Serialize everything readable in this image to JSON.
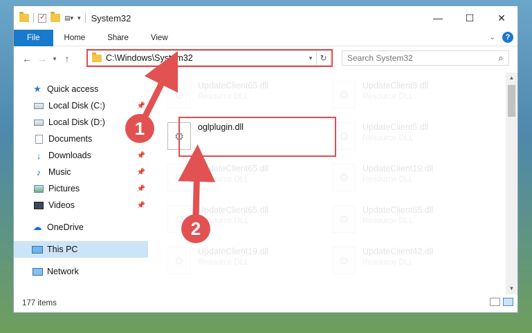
{
  "window": {
    "title": "System32",
    "controls": {
      "minimize": "—",
      "maximize": "☐",
      "close": "✕"
    }
  },
  "ribbon": {
    "tabs": [
      "File",
      "Home",
      "Share",
      "View"
    ]
  },
  "nav": {
    "address": "C:\\Windows\\System32",
    "search_placeholder": "Search System32"
  },
  "sidebar": {
    "items": [
      {
        "label": "Quick access",
        "icon": "star-icon",
        "pinned": false
      },
      {
        "label": "Local Disk (C:)",
        "icon": "disk-icon",
        "pinned": true
      },
      {
        "label": "Local Disk (D:)",
        "icon": "disk-icon",
        "pinned": false
      },
      {
        "label": "Documents",
        "icon": "document-icon",
        "pinned": true
      },
      {
        "label": "Downloads",
        "icon": "download-icon",
        "pinned": true
      },
      {
        "label": "Music",
        "icon": "music-icon",
        "pinned": true
      },
      {
        "label": "Pictures",
        "icon": "pictures-icon",
        "pinned": true
      },
      {
        "label": "Videos",
        "icon": "videos-icon",
        "pinned": true
      },
      {
        "label": "OneDrive",
        "icon": "cloud-icon",
        "pinned": false
      },
      {
        "label": "This PC",
        "icon": "computer-icon",
        "pinned": false,
        "selected": true
      },
      {
        "label": "Network",
        "icon": "network-icon",
        "pinned": false
      }
    ]
  },
  "files": [
    {
      "name": "UpdateClient65.dll",
      "type": "Resource DLL"
    },
    {
      "name": "UpdateClient5.dll",
      "type": "Resource DLL"
    },
    {
      "name": "oglplugin.dll",
      "type": ""
    },
    {
      "name": "UpdateClient5.dll",
      "type": "Resource DLL"
    },
    {
      "name": "UpdateClient65.dll",
      "type": "Resource DLL"
    },
    {
      "name": "UpdateClient19.dll",
      "type": "Resource DLL"
    },
    {
      "name": "UpdateClient65.dll",
      "type": "Resource DLL"
    },
    {
      "name": "UpdateClient65.dll",
      "type": "Resource DLL"
    },
    {
      "name": "UpdateClient19.dll",
      "type": "Resource DLL"
    },
    {
      "name": "UpdateClient42.dll",
      "type": "Resource DLL"
    }
  ],
  "status": {
    "item_count": "177 items"
  },
  "annotations": {
    "step1": "1",
    "step2": "2",
    "color": "#e25252"
  }
}
